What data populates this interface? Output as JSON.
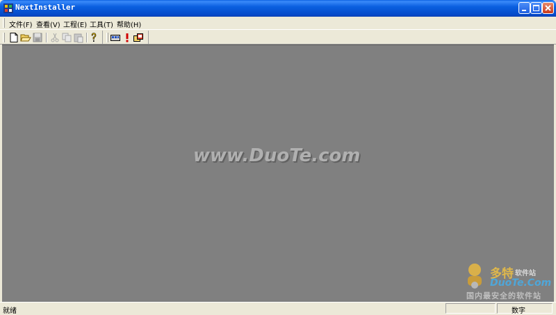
{
  "window": {
    "title": "NextInstaller"
  },
  "menu": {
    "items": [
      {
        "label": "文件(F)"
      },
      {
        "label": "查看(V)"
      },
      {
        "label": "工程(E)"
      },
      {
        "label": "工具(T)"
      },
      {
        "label": "帮助(H)"
      }
    ]
  },
  "toolbar": {
    "buttons": [
      {
        "icon": "new-file-icon"
      },
      {
        "icon": "open-folder-icon"
      },
      {
        "icon": "save-icon"
      },
      {
        "icon": "cut-icon"
      },
      {
        "icon": "copy-icon"
      },
      {
        "icon": "paste-icon"
      },
      {
        "icon": "help-icon"
      },
      {
        "icon": "build-icon"
      },
      {
        "icon": "run-icon"
      },
      {
        "icon": "wizard-icon"
      }
    ]
  },
  "watermark": {
    "text": "www.DuoTe.com",
    "logo_title": "多特",
    "logo_sub": "软件站",
    "logo_url": "DuoTe.Com",
    "logo_slogan": "国内最安全的软件站"
  },
  "status": {
    "text": "就绪",
    "pane": "数字"
  },
  "colors": {
    "titlebar": "#0A5FE0",
    "client": "#808080",
    "chrome": "#ECE9D8"
  }
}
